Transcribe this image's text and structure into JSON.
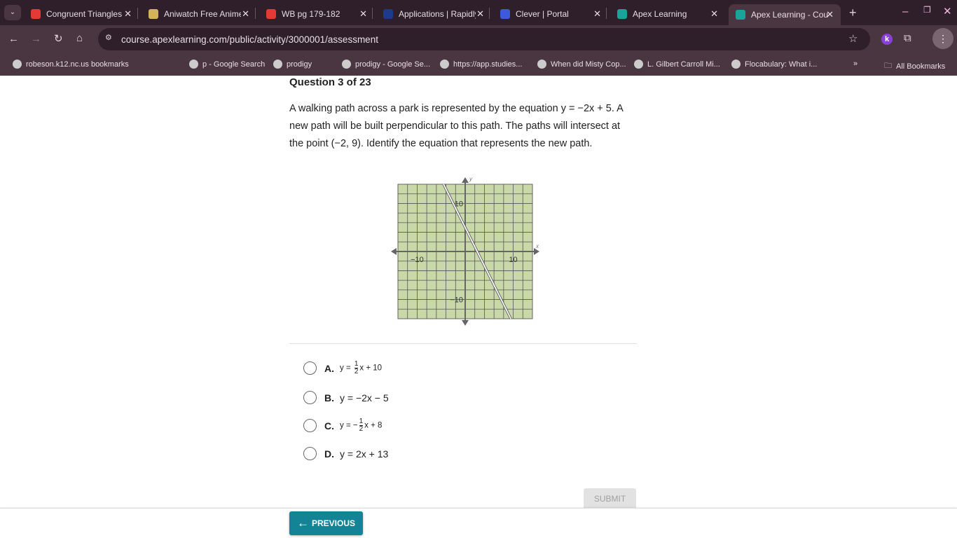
{
  "browser": {
    "tabs": [
      {
        "title": "Congruent Triangles",
        "color": "#e53935"
      },
      {
        "title": "Aniwatch Free Anime",
        "color": "#d4b25a"
      },
      {
        "title": "WB pg 179-182",
        "color": "#e53935"
      },
      {
        "title": "Applications | Rapidly",
        "color": "#1e3a8a"
      },
      {
        "title": "Clever | Portal",
        "color": "#3b5bdb"
      },
      {
        "title": "Apex Learning",
        "color": "#1aa39b"
      },
      {
        "title": "Apex Learning - Course",
        "color": "#1aa39b"
      }
    ],
    "url": "course.apexlearning.com/public/activity/3000001/assessment",
    "bookmarks": [
      "robeson.k12.nc.us bookmarks",
      "p - Google Search",
      "prodigy",
      "prodigy - Google Se...",
      "https://app.studies...",
      "When did Misty Cop...",
      "L. Gilbert Carroll Mi...",
      "Flocabulary: What i..."
    ],
    "all_bookmarks": "All Bookmarks",
    "profile_initial": "k"
  },
  "question": {
    "number": "Question 3 of 23",
    "text": "A walking path across a park is represented by the equation y = −2x + 5. A new path will be built perpendicular to this path. The paths will intersect at the point (−2, 9). Identify the equation that represents the new path.",
    "options": [
      {
        "letter": "A.",
        "pre": "y = ",
        "num": "1",
        "den": "2",
        "post": "x + 10"
      },
      {
        "letter": "B.",
        "text": "y = −2x − 5"
      },
      {
        "letter": "C.",
        "pre": "y = −",
        "num": "1",
        "den": "2",
        "post": "x + 8"
      },
      {
        "letter": "D.",
        "text": "y = 2x + 13"
      }
    ],
    "submit": "SUBMIT",
    "previous": "PREVIOUS"
  },
  "chart_data": {
    "type": "line",
    "xlabel": "x",
    "ylabel": "y",
    "xlim": [
      -14,
      14
    ],
    "ylim": [
      -14,
      14
    ],
    "grid": true,
    "grid_step": 2,
    "x_ticks": [
      "−10",
      "10"
    ],
    "y_ticks": [
      "10",
      "−10"
    ],
    "series": [
      {
        "equation": "y = -2x + 5",
        "x": [
          -4.5,
          9.5
        ],
        "y": [
          14,
          -14
        ]
      }
    ],
    "colors": {
      "background": "#c9d8a8",
      "line": "#ffffff"
    }
  }
}
